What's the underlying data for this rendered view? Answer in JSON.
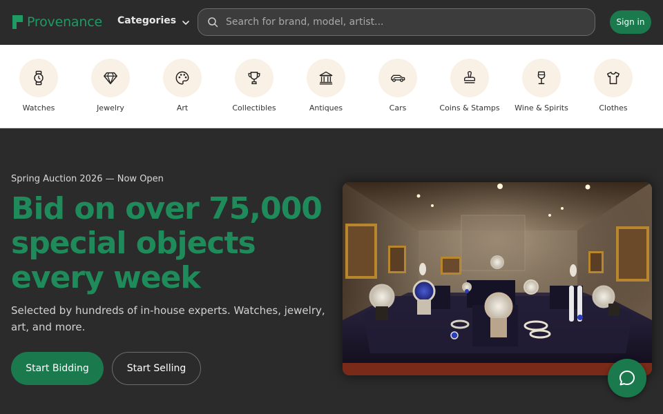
{
  "header": {
    "brand": "Provenance",
    "categories_label": "Categories",
    "search_placeholder": "Search for brand, model, artist...",
    "signin_label": "Sign in"
  },
  "categories": [
    {
      "label": "Watches",
      "icon": "watch-icon"
    },
    {
      "label": "Jewelry",
      "icon": "diamond-icon"
    },
    {
      "label": "Art",
      "icon": "palette-icon"
    },
    {
      "label": "Collectibles",
      "icon": "trophy-icon"
    },
    {
      "label": "Antiques",
      "icon": "museum-icon"
    },
    {
      "label": "Cars",
      "icon": "car-icon"
    },
    {
      "label": "Coins & Stamps",
      "icon": "stamp-icon"
    },
    {
      "label": "Wine & Spirits",
      "icon": "wine-glass-icon"
    },
    {
      "label": "Clothes",
      "icon": "shirt-icon"
    }
  ],
  "hero": {
    "eyebrow": "Spring Auction 2026 — Now Open",
    "headline": "Bid on over 75,000 special objects every week",
    "subtext": "Selected by hundreds of in-house experts. Watches, jewelry, art, and more.",
    "primary_cta": "Start Bidding",
    "secondary_cta": "Start Selling"
  },
  "colors": {
    "accent": "#1a7a4e",
    "accent_text": "#1f8b5a",
    "background": "#2b2b2b",
    "category_circle": "#faf1e6"
  }
}
